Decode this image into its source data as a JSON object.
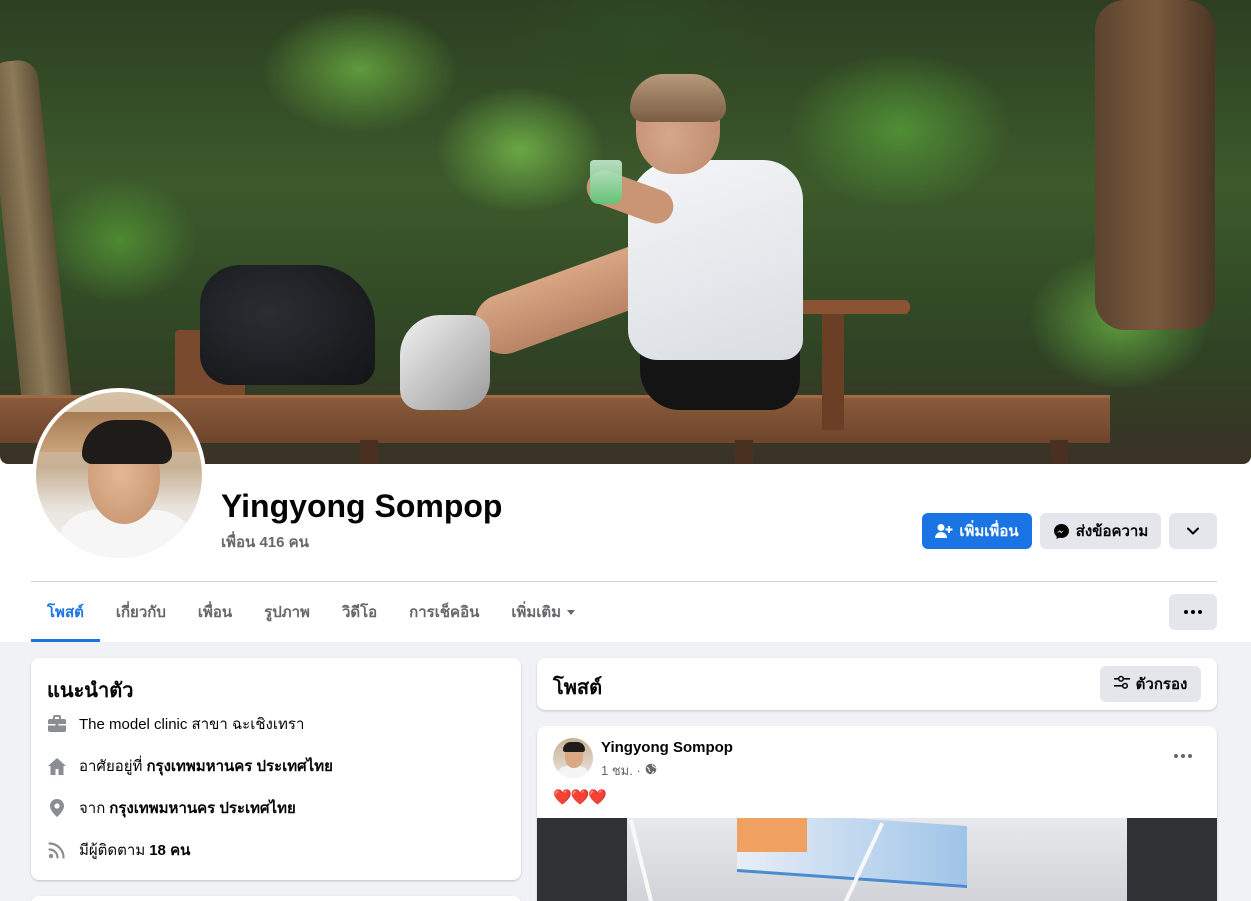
{
  "profile": {
    "name": "Yingyong Sompop",
    "friends": "เพื่อน 416 คน"
  },
  "actions": {
    "add_friend": "เพิ่มเพื่อน",
    "message": "ส่งข้อความ"
  },
  "tabs": [
    {
      "label": "โพสต์"
    },
    {
      "label": "เกี่ยวกับ"
    },
    {
      "label": "เพื่อน"
    },
    {
      "label": "รูปภาพ"
    },
    {
      "label": "วิดีโอ"
    },
    {
      "label": "การเช็คอิน"
    },
    {
      "label": "เพิ่มเติม"
    }
  ],
  "intro": {
    "title": "แนะนำตัว",
    "work": "The model clinic สาขา ฉะเชิงเทรา",
    "lives_prefix": "อาศัยอยู่ที่",
    "lives_place": "กรุงเทพมหานคร ประเทศไทย",
    "from_prefix": "จาก",
    "from_place": "กรุงเทพมหานคร ประเทศไทย",
    "followers_prefix": "มีผู้ติดตาม",
    "followers_count": "18 คน"
  },
  "posts": {
    "title": "โพสต์",
    "filter_label": "ตัวกรอง"
  },
  "post": {
    "author": "Yingyong Sompop",
    "time": "1 ชม. ·",
    "text": "❤️❤️❤️"
  },
  "colors": {
    "accent": "#1b74e4",
    "page_bg": "#f0f2f5",
    "secondary_btn": "#e4e6eb",
    "muted_text": "#65676b"
  },
  "icons": {
    "add_friend": "person-plus-icon",
    "message": "messenger-icon",
    "dropdown": "chevron-down-icon",
    "more": "more-horizontal-icon",
    "work": "briefcase-icon",
    "home": "home-icon",
    "location": "location-pin-icon",
    "followers": "rss-icon",
    "filter": "filter-sliders-icon",
    "audience": "globe-icon"
  }
}
